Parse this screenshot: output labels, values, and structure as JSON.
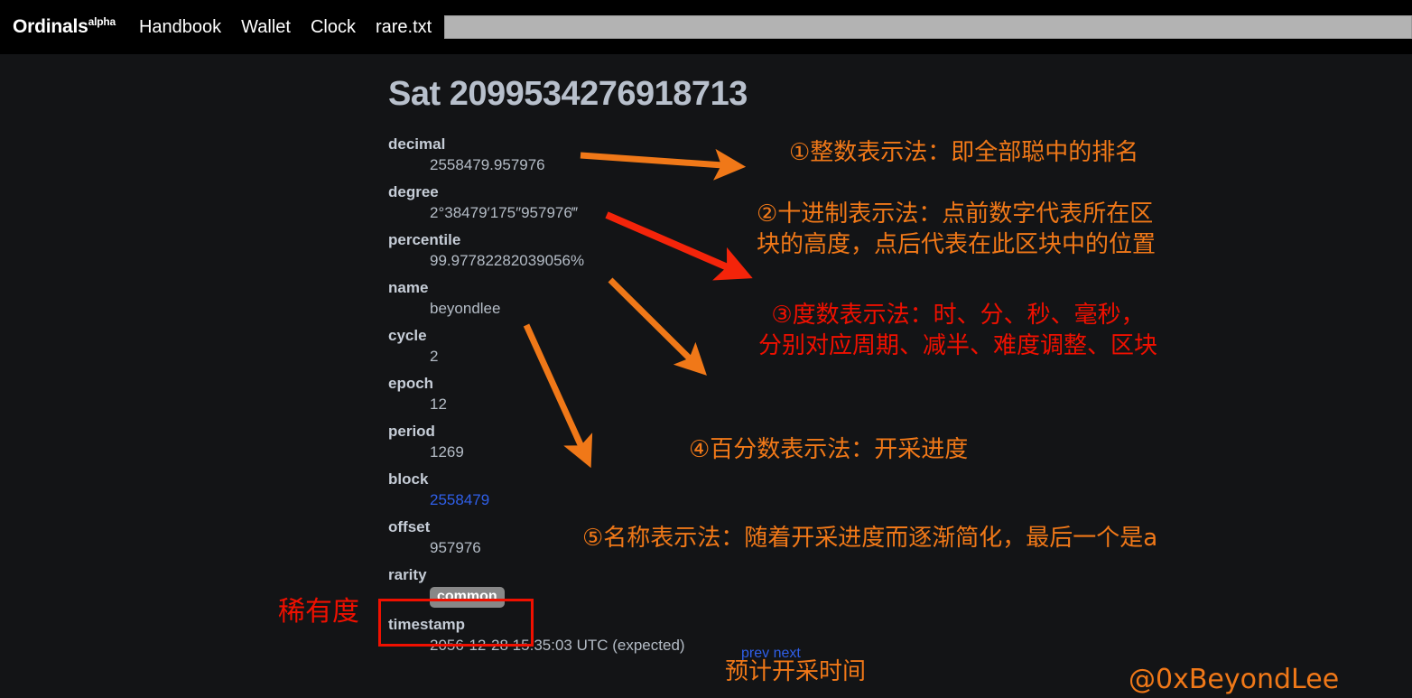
{
  "nav": {
    "brand": "Ordinals",
    "brand_sup": "alpha",
    "links": [
      {
        "label": "Handbook"
      },
      {
        "label": "Wallet"
      },
      {
        "label": "Clock"
      },
      {
        "label": "rare.txt"
      }
    ],
    "search": {
      "value": "",
      "placeholder": ""
    }
  },
  "page": {
    "title": "Sat 2099534276918713",
    "fields": [
      {
        "key": "decimal",
        "label": "decimal",
        "value": "2558479.957976",
        "style": "text"
      },
      {
        "key": "degree",
        "label": "degree",
        "value": "2°38479′175″957976‴",
        "style": "text"
      },
      {
        "key": "percentile",
        "label": "percentile",
        "value": "99.97782282039056%",
        "style": "text"
      },
      {
        "key": "name",
        "label": "name",
        "value": "beyondlee",
        "style": "text"
      },
      {
        "key": "cycle",
        "label": "cycle",
        "value": "2",
        "style": "text"
      },
      {
        "key": "epoch",
        "label": "epoch",
        "value": "12",
        "style": "text"
      },
      {
        "key": "period",
        "label": "period",
        "value": "1269",
        "style": "text"
      },
      {
        "key": "block",
        "label": "block",
        "value": "2558479",
        "style": "link"
      },
      {
        "key": "offset",
        "label": "offset",
        "value": "957976",
        "style": "text"
      },
      {
        "key": "rarity",
        "label": "rarity",
        "value": "common",
        "style": "badge"
      },
      {
        "key": "timestamp",
        "label": "timestamp",
        "value": "2056-12-28 15:35:03 UTC (expected)",
        "style": "text"
      }
    ],
    "pagination": {
      "prev": "prev",
      "next": "next"
    }
  },
  "annotations": {
    "item1": "①整数表示法：即全部聪中的排名",
    "item2": "②十进制表示法：点前数字代表所在区\n块的高度，点后代表在此区块中的位置",
    "item3": "③度数表示法：时、分、秒、毫秒，\n分别对应周期、减半、难度调整、区块",
    "item4": "④百分数表示法：开采进度",
    "item5": "⑤名称表示法：随着开采进度而逐渐简化，最后一个是a",
    "rarity_label": "稀有度",
    "mining_time_label": "预计开采时间",
    "watermark": "@0xBeyondLee"
  },
  "colors": {
    "nav_background": "#000000",
    "page_background": "#131416",
    "label_text": "#c5ccd6",
    "value_text": "#b4bcc6",
    "link_blue": "#2f5fe8",
    "annotation_orange": "#f07818",
    "annotation_red": "#f01000",
    "badge_background": "#888888",
    "highlight_box": "#f01000",
    "search_background": "#b3b3b3"
  }
}
